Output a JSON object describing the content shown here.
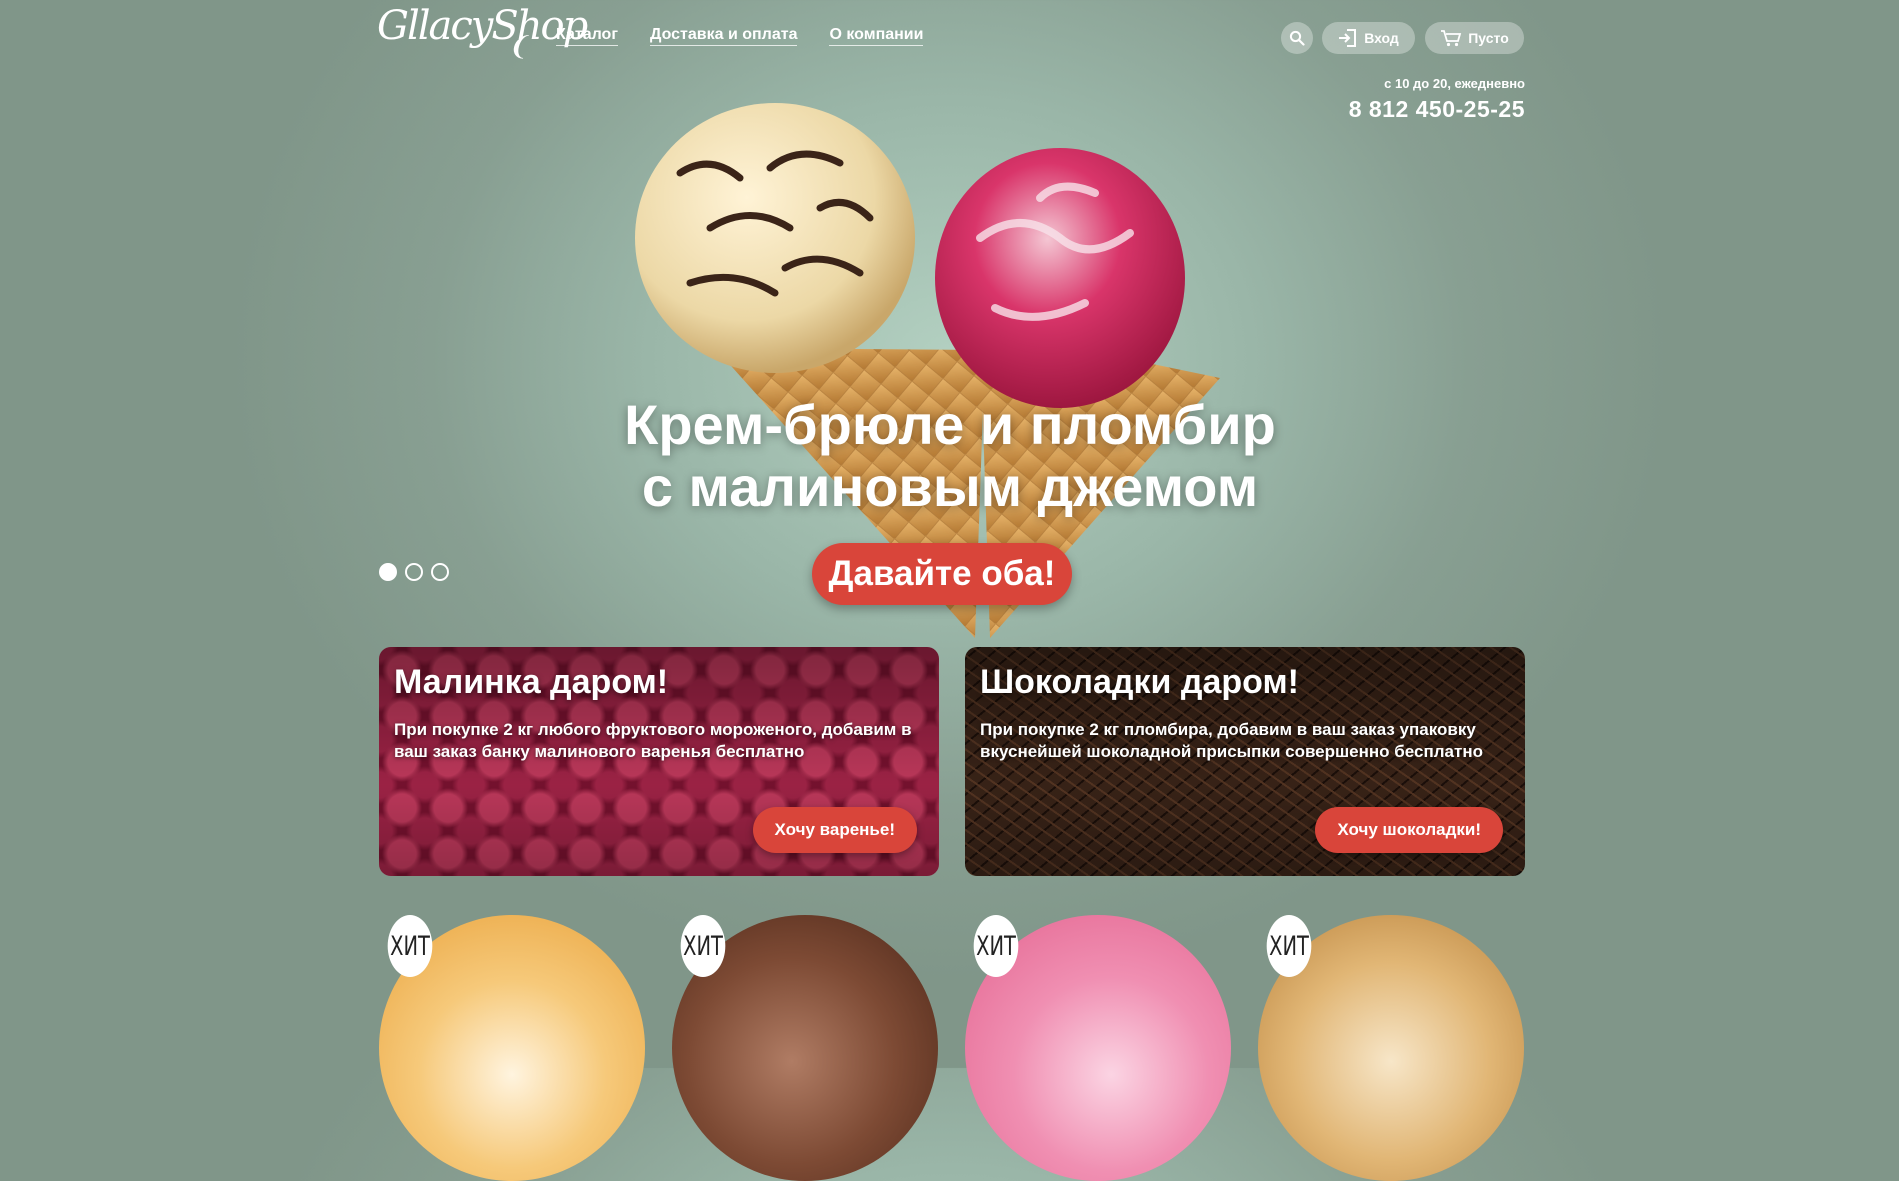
{
  "header": {
    "logo": "GllacyShop",
    "nav": [
      "Каталог",
      "Доставка и оплата",
      "О компании"
    ],
    "login_label": "Вход",
    "cart_label": "Пусто",
    "hours": "с 10 до 20, ежедневно",
    "phone": "8 812 450-25-25"
  },
  "hero": {
    "title_line1": "Крем-брюле и пломбир",
    "title_line2": "с малиновым джемом",
    "cta": "Давайте оба!",
    "slides_total": 3,
    "slide_active": 1
  },
  "promos": [
    {
      "title": "Малинка даром!",
      "text": "При покупке 2 кг любого фруктового мороженого, добавим в ваш заказ банку малинового варенья бесплатно",
      "button": "Хочу варенье!"
    },
    {
      "title": "Шоколадки даром!",
      "text": "При покупке 2 кг пломбира, добавим в ваш заказ упаковку вкуснейшей шоколадной присыпки совершенно бесплатно",
      "button": "Хочу шоколадки!"
    }
  ],
  "products": [
    {
      "badge": "ХИТ"
    },
    {
      "badge": "ХИТ"
    },
    {
      "badge": "ХИТ"
    },
    {
      "badge": "ХИТ"
    }
  ],
  "colors": {
    "accent": "#d9453a",
    "background": "#8aa596"
  },
  "icons": [
    "search-icon",
    "login-icon",
    "cart-icon"
  ]
}
